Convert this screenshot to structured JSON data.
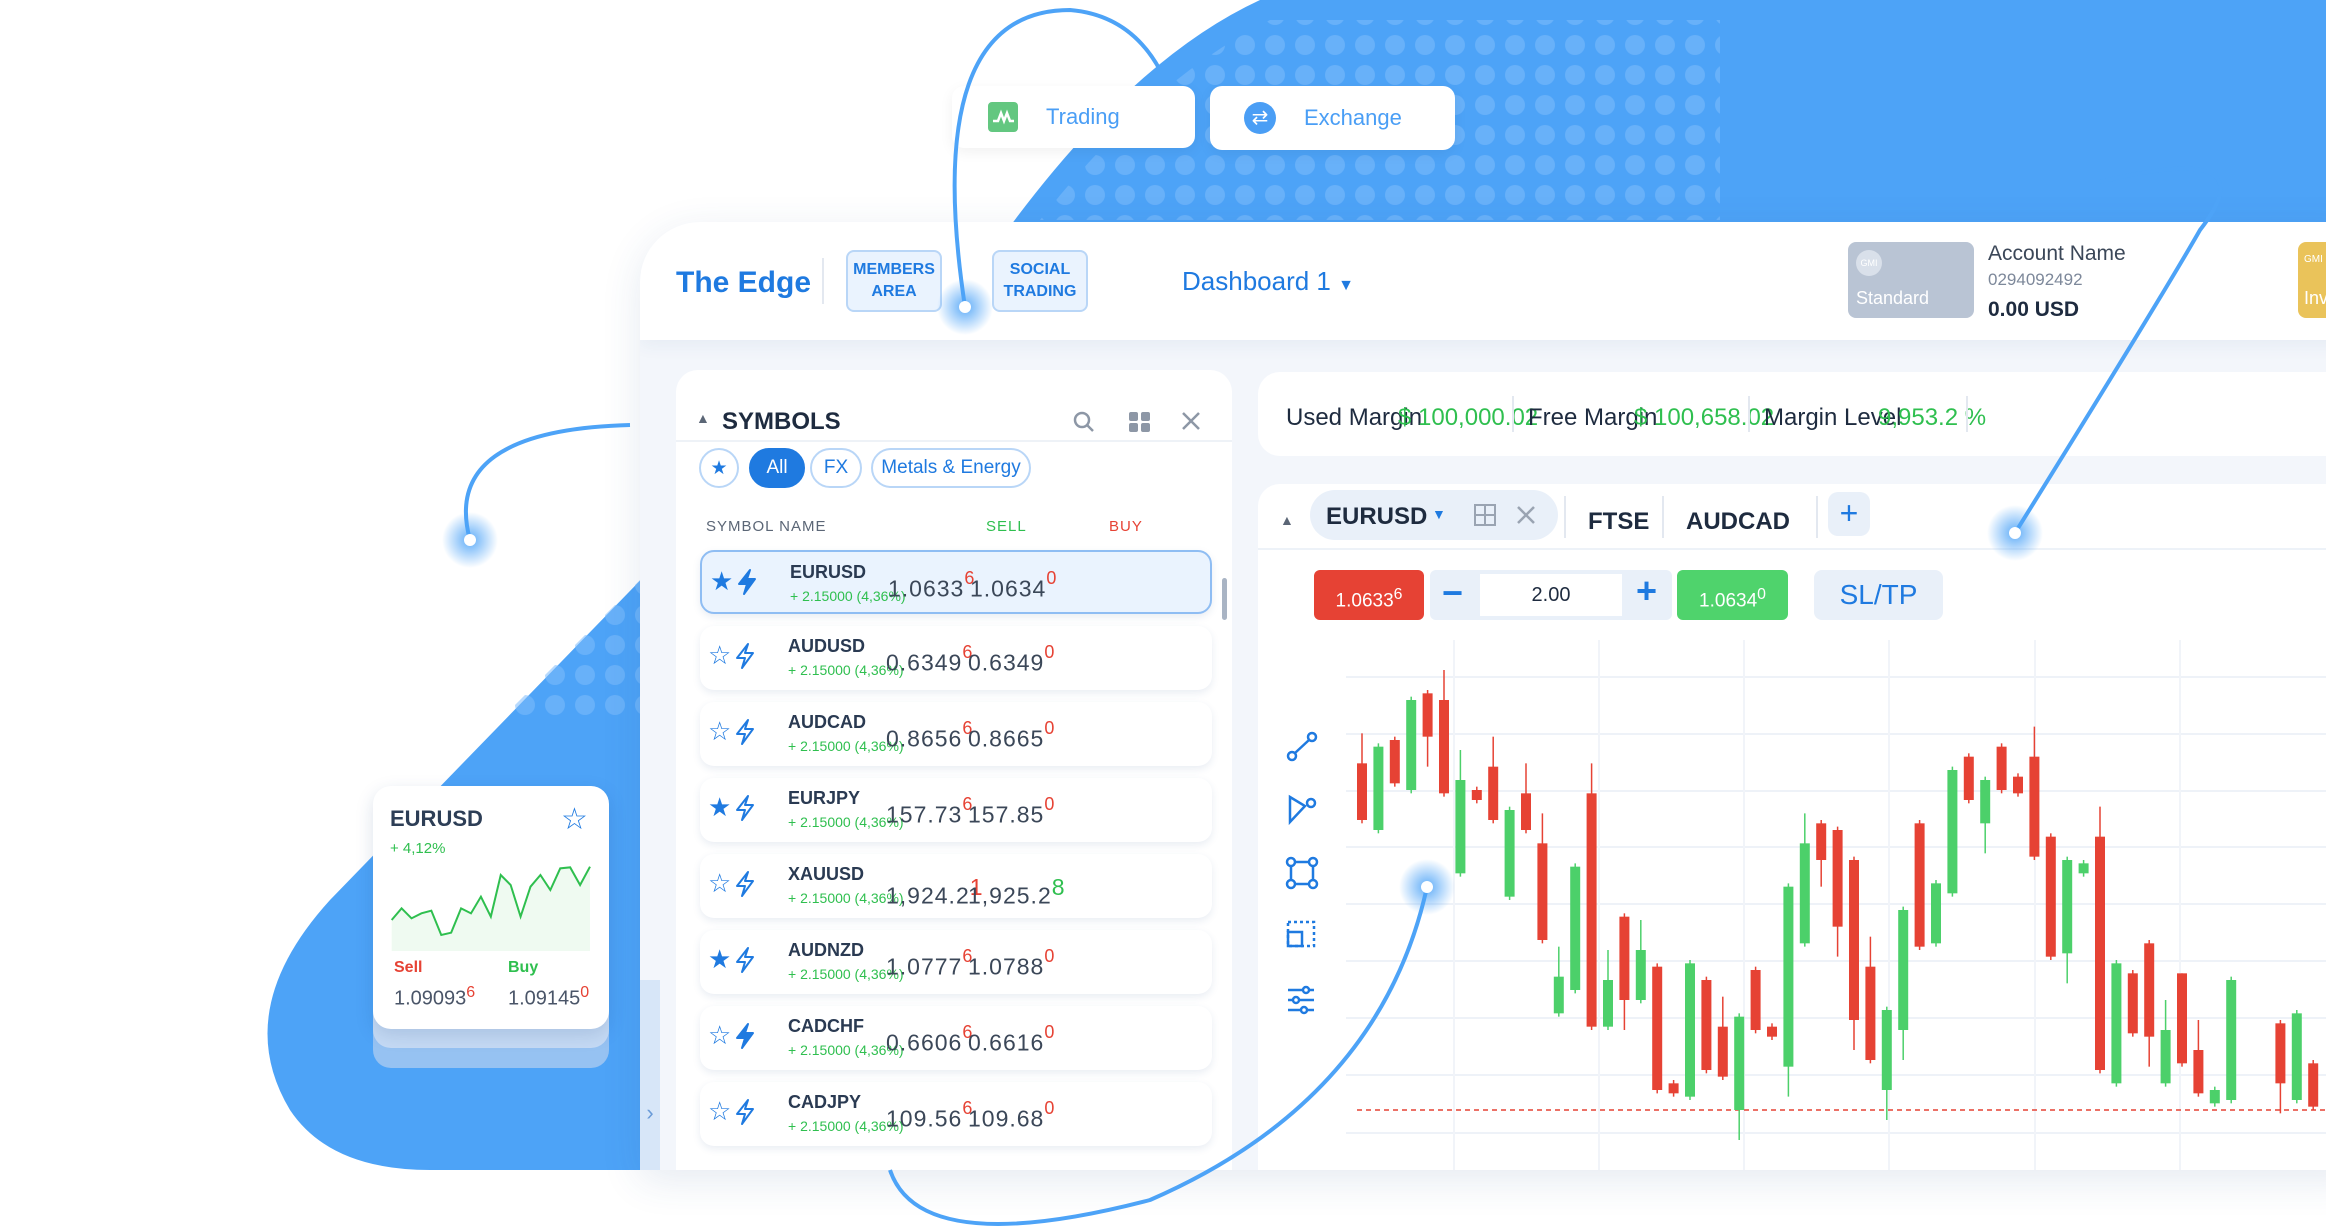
{
  "top_pills": {
    "trading": "Trading",
    "exchange": "Exchange"
  },
  "header": {
    "logo": "The Edge",
    "members_area": "MEMBERS AREA",
    "social_trading": "SOCIAL TRADING",
    "dashboard": "Dashboard 1",
    "account": {
      "badge_logo": "GMI",
      "badge_type": "Standard",
      "name": "Account Name",
      "number": "0294092492",
      "balance": "0.00 USD"
    },
    "second_badge": {
      "logo": "GMI",
      "type": "Inv"
    }
  },
  "symbols": {
    "title": "SYMBOLS",
    "filters": [
      "All",
      "FX",
      "Metals & Energy"
    ],
    "active_filter": "All",
    "columns": {
      "name": "SYMBOL NAME",
      "sell": "SELL",
      "buy": "BUY"
    },
    "rows": [
      {
        "name": "EURUSD",
        "change": "+ 2.15000 (4,36%)",
        "sell": "1.0633",
        "sell_sup": "6",
        "buy": "1.0634",
        "buy_sup": "0",
        "fav": true,
        "bolt_filled": true,
        "selected": true
      },
      {
        "name": "AUDUSD",
        "change": "+ 2.15000 (4,36%)",
        "sell": "0.6349",
        "sell_sup": "6",
        "buy": "0.6349",
        "buy_sup": "0",
        "fav": false,
        "bolt_filled": false
      },
      {
        "name": "AUDCAD",
        "change": "+ 2.15000 (4,36%)",
        "sell": "0.8656",
        "sell_sup": "6",
        "buy": "0.8665",
        "buy_sup": "0",
        "fav": false,
        "bolt_filled": false
      },
      {
        "name": "EURJPY",
        "change": "+ 2.15000 (4,36%)",
        "sell": "157.73",
        "sell_sup": "6",
        "buy": "157.85",
        "buy_sup": "0",
        "fav": true,
        "bolt_filled": false
      },
      {
        "name": "XAUUSD",
        "change": "+ 2.15000 (4,36%)",
        "sell": "1,924.2",
        "sell_sup": "1",
        "buy": "1,925.2",
        "buy_sup": "8",
        "buy_sup_color": "#2fbf4f",
        "fav": false,
        "bolt_filled": false,
        "inline_sup": true
      },
      {
        "name": "AUDNZD",
        "change": "+ 2.15000 (4,36%)",
        "sell": "1.0777",
        "sell_sup": "6",
        "buy": "1.0788",
        "buy_sup": "0",
        "fav": true,
        "bolt_filled": false
      },
      {
        "name": "CADCHF",
        "change": "+ 2.15000 (4,36%)",
        "sell": "0.6606",
        "sell_sup": "6",
        "buy": "0.6616",
        "buy_sup": "0",
        "fav": false,
        "bolt_filled": true
      },
      {
        "name": "CADJPY",
        "change": "+ 2.15000 (4,36%)",
        "sell": "109.56",
        "sell_sup": "6",
        "buy": "109.68",
        "buy_sup": "0",
        "fav": false,
        "bolt_filled": false
      }
    ]
  },
  "margin": {
    "used_label": "Used Margin",
    "used_value": "$ 100,000.02",
    "free_label": "Free Margin",
    "free_value": "$ 100,658.02",
    "level_label": "Margin Level",
    "level_value": "9,953.2 %"
  },
  "chart_panel": {
    "tabs": [
      "EURUSD",
      "FTSE",
      "AUDCAD"
    ],
    "active_tab": "EURUSD",
    "sell_price": "1.0633",
    "sell_sup": "6",
    "lot": "2.00",
    "buy_price": "1.0634",
    "buy_sup": "0",
    "sltp": "SL/TP"
  },
  "chart_data": {
    "type": "candlestick",
    "up_color": "#4cd06a",
    "down_color": "#e64234",
    "grid": true,
    "current_price_line": 9,
    "candles": [
      [
        113,
        122,
        95,
        96
      ],
      [
        93,
        119,
        92,
        118
      ],
      [
        120,
        121,
        106,
        107
      ],
      [
        105,
        133,
        104,
        132
      ],
      [
        134,
        135,
        112,
        121
      ],
      [
        132,
        141,
        103,
        104
      ],
      [
        80,
        117,
        79,
        108
      ],
      [
        105,
        106,
        101,
        102
      ],
      [
        112,
        121,
        95,
        96
      ],
      [
        73,
        100,
        72,
        99
      ],
      [
        104,
        113,
        92,
        93
      ],
      [
        89,
        98,
        59,
        60
      ],
      [
        38,
        58,
        37,
        49
      ],
      [
        45,
        83,
        44,
        82
      ],
      [
        104,
        113,
        33,
        34
      ],
      [
        34,
        57,
        33,
        48
      ],
      [
        67,
        68,
        33,
        42
      ],
      [
        42,
        66,
        41,
        57
      ],
      [
        52,
        53,
        14,
        15
      ],
      [
        17,
        18,
        13,
        14
      ],
      [
        13,
        54,
        12,
        53
      ],
      [
        48,
        49,
        20,
        21
      ],
      [
        34,
        43,
        18,
        19
      ],
      [
        9,
        38,
        0,
        37
      ],
      [
        51,
        52,
        32,
        33
      ],
      [
        34,
        35,
        30,
        31
      ],
      [
        22,
        77,
        13,
        76
      ],
      [
        59,
        98,
        58,
        89
      ],
      [
        95,
        96,
        76,
        84
      ],
      [
        93,
        94,
        55,
        64
      ],
      [
        84,
        85,
        27,
        36
      ],
      [
        52,
        61,
        23,
        24
      ],
      [
        15,
        40,
        6,
        39
      ],
      [
        33,
        70,
        24,
        69
      ],
      [
        95,
        96,
        57,
        58
      ],
      [
        59,
        78,
        58,
        77
      ],
      [
        74,
        112,
        73,
        111
      ],
      [
        115,
        116,
        101,
        102
      ],
      [
        95,
        109,
        86,
        108
      ],
      [
        118,
        119,
        104,
        105
      ],
      [
        109,
        110,
        103,
        104
      ],
      [
        115,
        124,
        84,
        85
      ],
      [
        91,
        92,
        54,
        55
      ],
      [
        56,
        85,
        47,
        84
      ],
      [
        80,
        84,
        79,
        83
      ],
      [
        91,
        100,
        20,
        21
      ],
      [
        17,
        54,
        16,
        53
      ],
      [
        50,
        51,
        31,
        32
      ],
      [
        59,
        60,
        22,
        31
      ],
      [
        17,
        42,
        16,
        33
      ],
      [
        50,
        50,
        22,
        23
      ],
      [
        27,
        36,
        13,
        14
      ],
      [
        11,
        16,
        10,
        15
      ],
      [
        12,
        49,
        11,
        48
      ],
      null,
      null,
      [
        35,
        36,
        8,
        17
      ],
      [
        12,
        39,
        11,
        38
      ],
      [
        23,
        24,
        9,
        10
      ]
    ]
  },
  "mini_card": {
    "symbol": "EURUSD",
    "change": "+ 4,12%",
    "sell_label": "Sell",
    "sell": "1.09093",
    "sell_sup": "6",
    "buy_label": "Buy",
    "buy": "1.09145",
    "buy_sup": "0",
    "sparkline": [
      6,
      9.5,
      6.5,
      8,
      8.8,
      1.5,
      2.2,
      9.5,
      8,
      13,
      7,
      19.5,
      16.5,
      7,
      16,
      19.5,
      15,
      21.5,
      21.8,
      16.5,
      22
    ]
  },
  "colors": {
    "brand": "#1f7ae0",
    "bg_blue": "#4da3f7",
    "up": "#2fbf4f",
    "down": "#e64234"
  }
}
